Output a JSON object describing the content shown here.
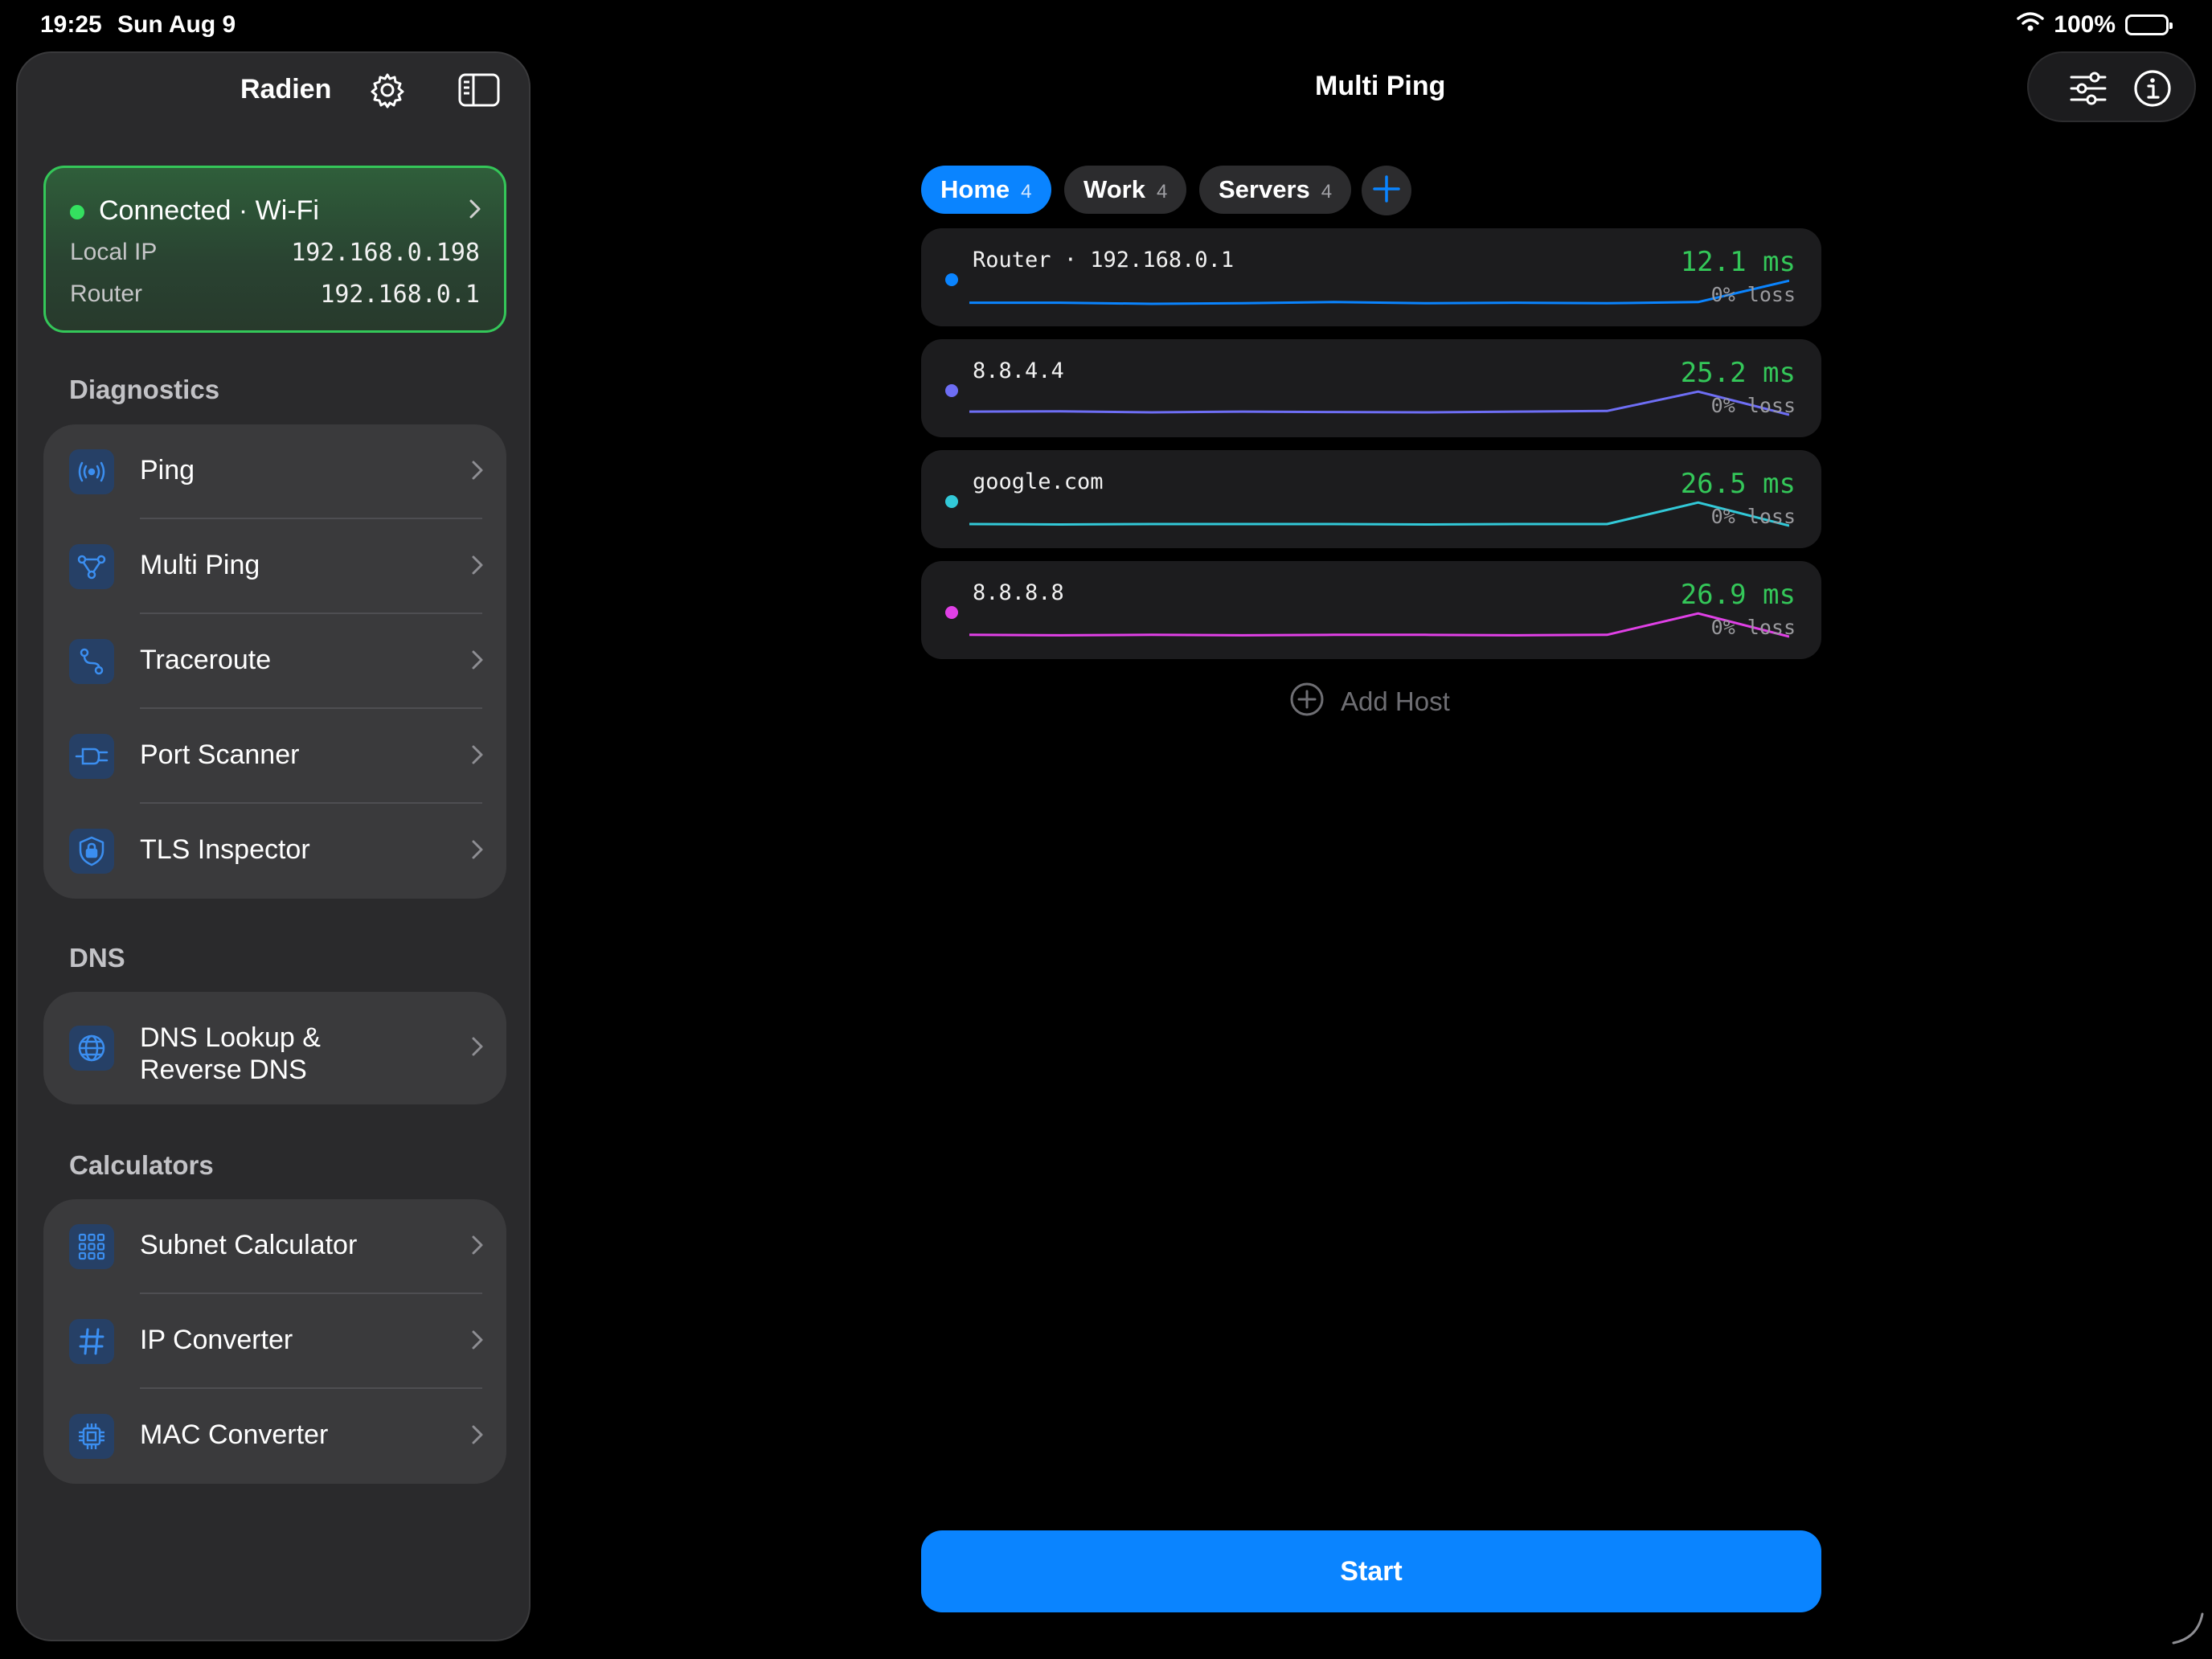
{
  "status_bar": {
    "time": "19:25",
    "date": "Sun Aug 9",
    "battery": "100%"
  },
  "sidebar": {
    "title": "Radien",
    "connection": {
      "title": "Connected · Wi-Fi",
      "status_color": "#34c759",
      "rows": [
        {
          "label": "Local IP",
          "value": "192.168.0.198"
        },
        {
          "label": "Router",
          "value": "192.168.0.1"
        }
      ]
    },
    "sections": [
      {
        "title": "Diagnostics",
        "items": [
          {
            "label": "Ping",
            "icon": "antenna-icon"
          },
          {
            "label": "Multi Ping",
            "icon": "network-nodes-icon"
          },
          {
            "label": "Traceroute",
            "icon": "route-icon"
          },
          {
            "label": "Port Scanner",
            "icon": "plug-icon"
          },
          {
            "label": "TLS Inspector",
            "icon": "lock-shield-icon"
          }
        ]
      },
      {
        "title": "DNS",
        "items": [
          {
            "label_line1": "DNS Lookup &",
            "label_line2": "Reverse DNS",
            "icon": "globe-icon"
          }
        ]
      },
      {
        "title": "Calculators",
        "items": [
          {
            "label": "Subnet Calculator",
            "icon": "grid-icon"
          },
          {
            "label": "IP Converter",
            "icon": "hash-icon"
          },
          {
            "label": "MAC Converter",
            "icon": "chip-icon"
          }
        ]
      }
    ]
  },
  "main": {
    "title": "Multi Ping",
    "tabs": [
      {
        "name": "Home",
        "count": "4"
      },
      {
        "name": "Work",
        "count": "4"
      },
      {
        "name": "Servers",
        "count": "4"
      }
    ],
    "accent": "#0a84ff",
    "hosts": [
      {
        "name": "Router · 192.168.0.1",
        "latency": "12.1 ms",
        "loss": "0% loss",
        "color": "#0a84ff",
        "history": [
          12.3,
          12.3,
          12.1,
          12.2,
          12.4,
          12.2,
          12.3,
          12.2,
          12.4,
          16.1
        ]
      },
      {
        "name": "8.8.4.4",
        "latency": "25.2 ms",
        "loss": "0% loss",
        "color": "#6e6ef5",
        "history": [
          26.1,
          26.2,
          25.9,
          26.1,
          26.0,
          25.9,
          26.1,
          26.3,
          31.9,
          25.2
        ]
      },
      {
        "name": "google.com",
        "latency": "26.5 ms",
        "loss": "0% loss",
        "color": "#32c9d8",
        "history": [
          26.9,
          26.8,
          26.9,
          26.9,
          26.9,
          26.8,
          26.9,
          26.9,
          32.4,
          26.5
        ]
      },
      {
        "name": "8.8.8.8",
        "latency": "26.9 ms",
        "loss": "0% loss",
        "color": "#e040e6",
        "history": [
          27.3,
          27.2,
          27.3,
          27.2,
          27.3,
          27.3,
          27.2,
          27.3,
          32.2,
          26.9
        ]
      }
    ],
    "add_host_label": "Add Host",
    "start_label": "Start"
  }
}
